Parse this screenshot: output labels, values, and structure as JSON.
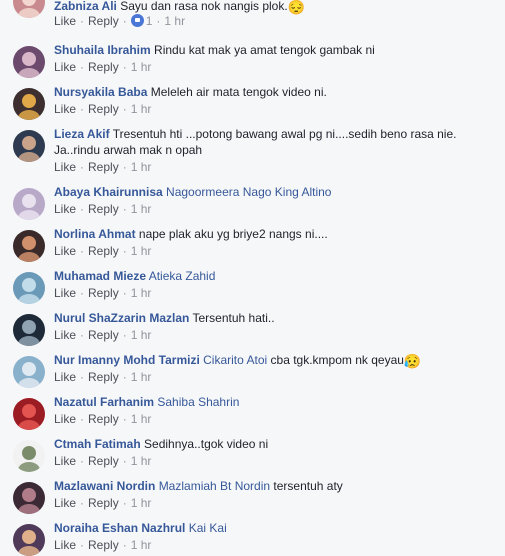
{
  "labels": {
    "like": "Like",
    "reply": "Reply",
    "sep": "·"
  },
  "comments": [
    {
      "author": "Zabniza Ali",
      "tag": "",
      "text": "Sayu dan rasa nok nangis plok.",
      "emoji": "😔",
      "reactions": "1",
      "time": "1 hr",
      "avatar_colors": [
        "#c98a8f",
        "#f2d6cf"
      ]
    },
    {
      "author": "Shuhaila Ibrahim",
      "tag": "",
      "text": "Rindu kat mak ya amat tengok gambak ni",
      "emoji": "",
      "reactions": "",
      "time": "1 hr",
      "avatar_colors": [
        "#6b4a6e",
        "#d9b7c9"
      ]
    },
    {
      "author": "Nursyakila Baba",
      "tag": "",
      "text": "Meleleh air mata tengok video ni.",
      "emoji": "",
      "reactions": "",
      "time": "1 hr",
      "avatar_colors": [
        "#3d2f2f",
        "#e0a848"
      ]
    },
    {
      "author": "Lieza Akif",
      "tag": "",
      "text": "Tresentuh hti ...potong bawang awal pg ni....sedih beno rasa nie. Ja..rindu arwah mak n opah",
      "emoji": "",
      "reactions": "",
      "time": "1 hr",
      "avatar_colors": [
        "#2e3a4f",
        "#c9a48a"
      ]
    },
    {
      "author": "Abaya Khairunnisa",
      "tag": "Nagoormeera Nago King Altino",
      "text": "",
      "emoji": "",
      "reactions": "",
      "time": "1 hr",
      "avatar_colors": [
        "#b9a9c9",
        "#e8e2ef"
      ]
    },
    {
      "author": "Norlina Ahmat",
      "tag": "",
      "text": "nape plak aku yg briye2 nangs ni....",
      "emoji": "",
      "reactions": "",
      "time": "1 hr",
      "avatar_colors": [
        "#3a2a2a",
        "#d0906b"
      ]
    },
    {
      "author": "Muhamad Mieze",
      "tag": "Atieka Zahid",
      "text": "",
      "emoji": "",
      "reactions": "",
      "time": "1 hr",
      "avatar_colors": [
        "#6a9ab8",
        "#c2dcea"
      ]
    },
    {
      "author": "Nurul ShaZzarin Mazlan",
      "tag": "",
      "text": "Tersentuh hati..",
      "emoji": "",
      "reactions": "",
      "time": "1 hr",
      "avatar_colors": [
        "#1e2a38",
        "#8fa3b3"
      ]
    },
    {
      "author": "Nur Imanny Mohd Tarmizi",
      "tag": "Cikarito Atoi",
      "text": "cba tgk.kmpom nk qeyau",
      "emoji": "😥",
      "reactions": "",
      "time": "1 hr",
      "avatar_colors": [
        "#8ab1cc",
        "#dfe9f1"
      ]
    },
    {
      "author": "Nazatul Farhanim",
      "tag": "Sahiba Shahrin",
      "text": "",
      "emoji": "",
      "reactions": "",
      "time": "1 hr",
      "avatar_colors": [
        "#9c1c24",
        "#e3534f"
      ]
    },
    {
      "author": "Ctmah Fatimah",
      "tag": "",
      "text": "Sedihnya..tgok video ni",
      "emoji": "",
      "reactions": "",
      "time": "1 hr",
      "avatar_colors": [
        "#f2f2f2",
        "#7b8c6a"
      ]
    },
    {
      "author": "Mazlawani Nordin",
      "tag": "Mazlamiah Bt Nordin",
      "text": "tersentuh aty",
      "emoji": "",
      "reactions": "",
      "time": "1 hr",
      "avatar_colors": [
        "#3b2a35",
        "#b07c8a"
      ]
    },
    {
      "author": "Noraiha Eshan Nazhrul",
      "tag": "Kai Kai",
      "text": "",
      "emoji": "",
      "reactions": "",
      "time": "1 hr",
      "avatar_colors": [
        "#4f3a5a",
        "#e0b08a"
      ]
    }
  ]
}
